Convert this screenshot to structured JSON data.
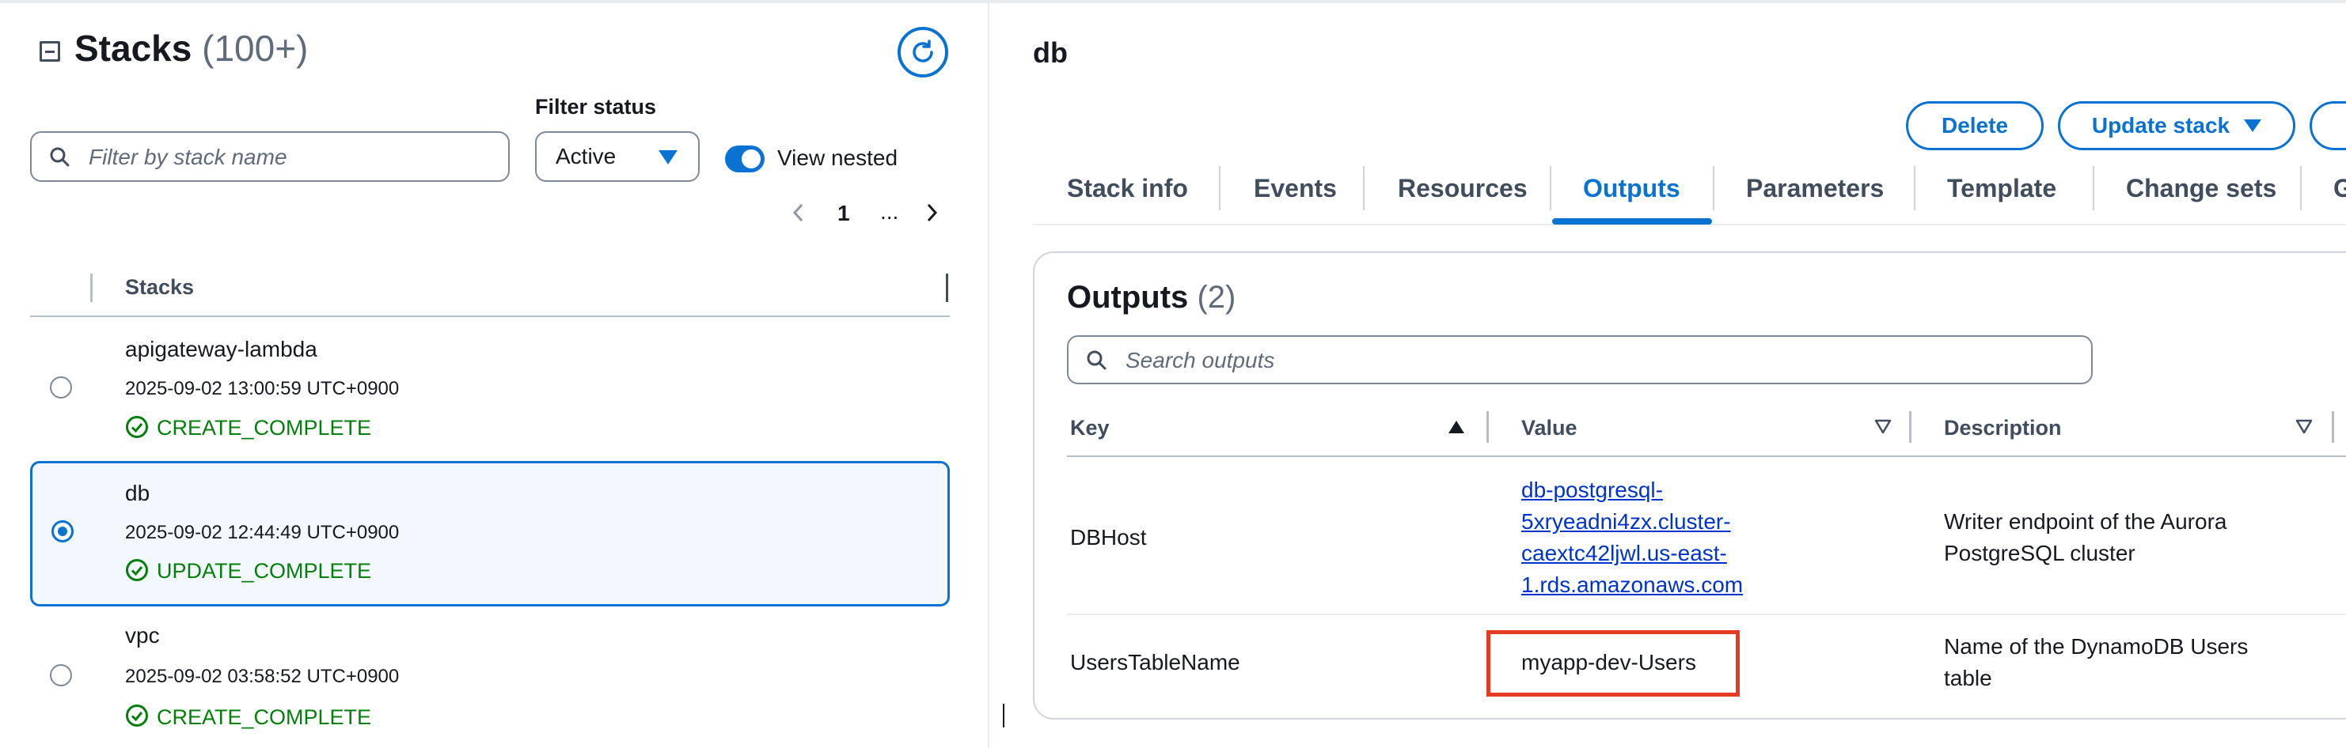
{
  "left_panel": {
    "title": "Stacks",
    "count": "(100+)",
    "search_placeholder": "Filter by stack name",
    "filter_status_label": "Filter status",
    "filter_status_value": "Active",
    "view_nested_label": "View nested",
    "view_nested_on": true,
    "pagination": {
      "current_page": "1",
      "ellipsis": "..."
    },
    "table_header": "Stacks",
    "stacks": [
      {
        "name": "apigateway-lambda",
        "date": "2025-09-02 13:00:59 UTC+0900",
        "status": "CREATE_COMPLETE",
        "selected": false
      },
      {
        "name": "db",
        "date": "2025-09-02 12:44:49 UTC+0900",
        "status": "UPDATE_COMPLETE",
        "selected": true
      },
      {
        "name": "vpc",
        "date": "2025-09-02 03:58:52 UTC+0900",
        "status": "CREATE_COMPLETE",
        "selected": false
      }
    ]
  },
  "right_panel": {
    "stack_title": "db",
    "actions": {
      "delete": "Delete",
      "update": "Update stack"
    },
    "tabs": [
      "Stack info",
      "Events",
      "Resources",
      "Outputs",
      "Parameters",
      "Template",
      "Change sets",
      "G"
    ],
    "active_tab": "Outputs",
    "outputs": {
      "title": "Outputs",
      "count": "(2)",
      "search_placeholder": "Search outputs",
      "columns": [
        "Key",
        "Value",
        "Description"
      ],
      "rows": [
        {
          "key": "DBHost",
          "value_lines": [
            "db-postgresql-",
            "5xryeadni4zx.cluster-",
            "caextc42ljwl.us-east-",
            "1.rds.amazonaws.com"
          ],
          "description_lines": [
            "Writer endpoint of the Aurora",
            "PostgreSQL cluster"
          ]
        },
        {
          "key": "UsersTableName",
          "value_lines": [
            "myapp-dev-Users"
          ],
          "description_lines": [
            "Name of the DynamoDB Users",
            "table"
          ]
        }
      ]
    }
  },
  "colors": {
    "accent": "#0972d3",
    "success": "#037f0c",
    "highlight": "#e53b22"
  }
}
